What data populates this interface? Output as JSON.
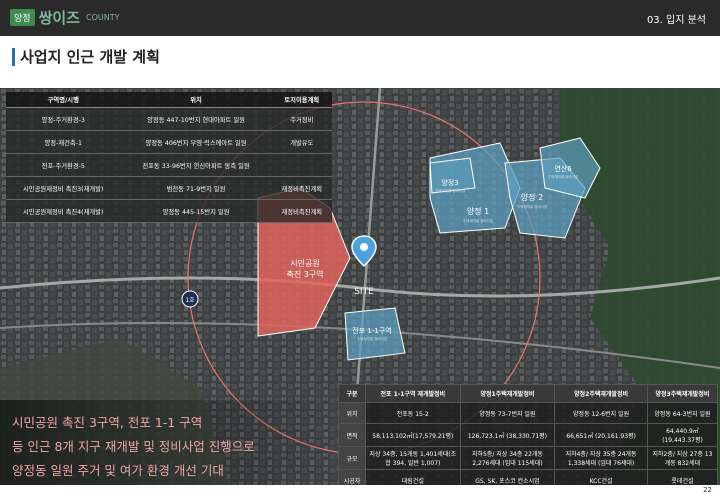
{
  "header": {
    "badge": "양정",
    "brand": "쌍이즈",
    "brand_sub": "COUNTY",
    "section": "03. 입지 분석"
  },
  "page": {
    "title": "사업지 인근 개발 계획",
    "number": "22"
  },
  "map_labels": {
    "site": "SITE",
    "line1": "1호",
    "zone_park_l1": "시민공원",
    "zone_park_l2": "촉진 3구역",
    "zone_yj3": "양정3",
    "zone_yj3_sub": "주택재개발 정비사업",
    "zone_yj1": "양정 1",
    "zone_yj1_sub": "주택재개발 정비사업",
    "zone_yj2": "양정 2",
    "zone_yj2_sub": "주택재개발 정비사업",
    "zone_ys6": "연산6",
    "zone_ys6_sub": "주택재개발 정비사업",
    "zone_jp11": "전포 1-1구역",
    "zone_jp11_sub": "주택재개발 정비사업"
  },
  "legend": {
    "headers": [
      "구역명/시행",
      "위치",
      "토지이용계획"
    ],
    "rows": [
      [
        "양정-주거환경-3",
        "양정동 447-10번지 현대아파트 일원",
        "주거정비"
      ],
      [
        "양정-재건축-1",
        "양정동 406번지 부영·럭스에아트 일원",
        "개발유도"
      ],
      [
        "전포-주거환경-5",
        "전포동 33-96번지 한신아파트 동측 일원",
        ""
      ],
      [
        "시민공원재정비 촉진3(재개발)",
        "범천동 71-9번지 일원",
        "재정비촉진계획"
      ],
      [
        "시민공원재정비 촉진4(재개발)",
        "양정동 445-15번지 일원",
        "재정비촉진계획"
      ]
    ]
  },
  "summary": {
    "line1": "시민공원 촉진 3구역, 전포 1-1 구역",
    "line2": "등 인근 8개 지구 재개발 및 정비사업 진행으로",
    "line3": "양정동 일원 주거 및 여가 환경 개선 기대"
  },
  "info": {
    "headers": [
      "구분",
      "전포 1-1구역 재개발정비",
      "양정1주택재개발정비",
      "양정2주택재개발정비",
      "양정3주택재개발정비"
    ],
    "rows": [
      [
        "위치",
        "전포동 15-2",
        "양정동 73-7번지 일원",
        "양정동 12-6번지 일원",
        "양정동 64-3번지 일원"
      ],
      [
        "면적",
        "58,113.102㎡(17,579.21평)",
        "126,723.1㎡ (38,330.71평)",
        "66,651㎡ (20,161.93평)",
        "64,440.9㎡ (19,443.37평)"
      ],
      [
        "규모",
        "지상 34층, 15개동 1,401세대(조합 394, 일반 1,007)",
        "지하5층/ 지상 34층 22개동 2,276세대 (임대 115세대)",
        "지하4층/ 지상 35층 24개동 1,338세대 (임대 76세대)",
        "지하2층/ 지상 27층 13개동 832세대"
      ],
      [
        "시공자",
        "대림건설",
        "GS, SK, 포스코 컨소시엄",
        "KCC건설",
        "롯데건설"
      ]
    ]
  },
  "colors": {
    "red_zone": "#e0645c",
    "blue_zone": "#5c9fbf",
    "circle": "#f07070"
  }
}
